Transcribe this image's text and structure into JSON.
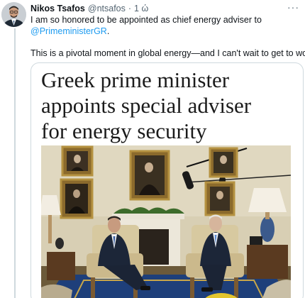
{
  "tweet": {
    "author_name": "Nikos Tsafos",
    "author_handle": "@ntsafos",
    "separator": "·",
    "timestamp": "1 ώ",
    "more_glyph": "···",
    "text_line1": "I am so honored to be appointed as chief energy adviser to",
    "mention": "@PrimeministerGR",
    "mention_suffix": ".",
    "text_line2": "This is a pivotal moment in global energy—and I can't wait to get to work."
  },
  "article": {
    "headline_line1": "Greek prime minister",
    "headline_line2": "appoints special adviser",
    "headline_line3": "for energy security"
  },
  "colors": {
    "link": "#1d9bf0",
    "text": "#0f1419",
    "secondary": "#536471",
    "border": "#cfd9de"
  },
  "icons": {
    "more": "more-horizontal-icon"
  }
}
